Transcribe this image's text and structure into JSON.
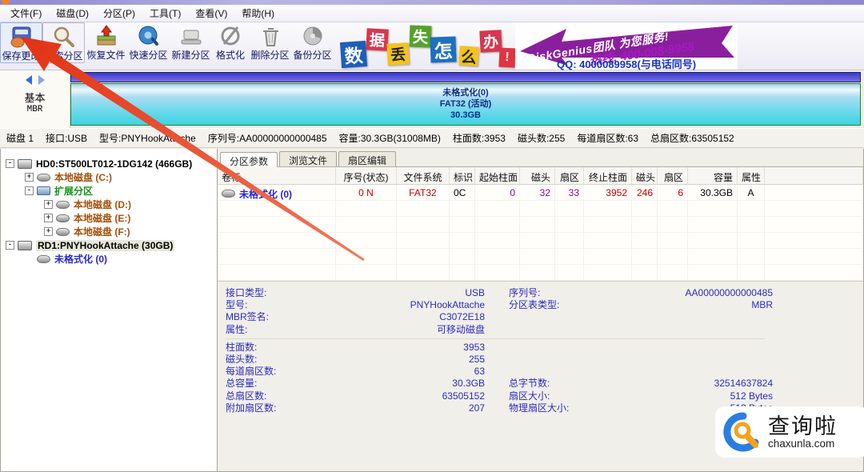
{
  "menu": {
    "items": [
      "文件(F)",
      "磁盘(D)",
      "分区(P)",
      "工具(T)",
      "查看(V)",
      "帮助(H)"
    ]
  },
  "toolbar": {
    "buttons": [
      {
        "label": "保存更改",
        "icon": "save-icon"
      },
      {
        "label": "搜索分区",
        "icon": "search-icon"
      },
      {
        "label": "恢复文件",
        "icon": "recover-icon"
      },
      {
        "label": "快速分区",
        "icon": "quick-partition-icon"
      },
      {
        "label": "新建分区",
        "icon": "new-partition-icon"
      },
      {
        "label": "格式化",
        "icon": "format-icon"
      },
      {
        "label": "删除分区",
        "icon": "trash-icon"
      },
      {
        "label": "备份分区",
        "icon": "backup-icon"
      }
    ]
  },
  "ad": {
    "slogan_chars": [
      "数",
      "据",
      "丢",
      "失",
      "怎",
      "么",
      "办",
      "!"
    ],
    "brand": "DiskGenius团队 为您服务!",
    "hotline": "热线: 400-008-9958",
    "qq": "QQ: 4000089958(与电话同号)",
    "arrow_color": "#8a1f9e"
  },
  "diskmap": {
    "kind": "基本",
    "table_type": "MBR",
    "partition": {
      "name": "未格式化(0)",
      "fs": "FAT32 (活动)",
      "size": "30.3GB"
    }
  },
  "diskinfo": {
    "segments": [
      "磁盘 1",
      "接口:USB",
      "型号:PNYHookAttache",
      "序列号:AA00000000000485",
      "容量:30.3GB(31008MB)",
      "柱面数:3953",
      "磁头数:255",
      "每道扇区数:63",
      "总扇区数:63505152"
    ]
  },
  "tree": {
    "items": [
      {
        "label": "HD0:ST500LT012-1DG142 (466GB)",
        "expander": "-"
      },
      {
        "label": "本地磁盘 (C:)",
        "expander": "+"
      },
      {
        "label": "扩展分区",
        "expander": "-"
      },
      {
        "label": "本地磁盘 (D:)",
        "expander": "+"
      },
      {
        "label": "本地磁盘 (E:)",
        "expander": "+"
      },
      {
        "label": "本地磁盘 (F:)",
        "expander": "+"
      },
      {
        "label": "RD1:PNYHookAttache (30GB)",
        "expander": "-"
      },
      {
        "label": "未格式化 (0)",
        "expander": ""
      }
    ]
  },
  "tabs": [
    {
      "label": "分区参数",
      "active": true
    },
    {
      "label": "浏览文件",
      "active": false
    },
    {
      "label": "扇区编辑",
      "active": false
    }
  ],
  "table": {
    "headers": [
      "卷标",
      "序号(状态)",
      "文件系统",
      "标识",
      "起始柱面",
      "磁头",
      "扇区",
      "终止柱面",
      "磁头",
      "扇区",
      "容量",
      "属性"
    ],
    "row": [
      "未格式化 (0)",
      "0 N",
      "FAT32",
      "0C",
      "0",
      "32",
      "33",
      "3952",
      "246",
      "6",
      "30.3GB",
      "A"
    ]
  },
  "details": {
    "rows": [
      {
        "l1": "接口类型:",
        "v1": "USB",
        "l2": "序列号:",
        "v2": "AA00000000000485"
      },
      {
        "l1": "型号:",
        "v1": "PNYHookAttache",
        "l2": "分区表类型:",
        "v2": "MBR"
      },
      {
        "l1": "MBR签名:",
        "v1": "C3072E18",
        "l2": "",
        "v2": ""
      },
      {
        "l1": "属性:",
        "v1": "可移动磁盘",
        "l2": "",
        "v2": ""
      },
      {
        "l1": "柱面数:",
        "v1": "3953",
        "l2": "",
        "v2": ""
      },
      {
        "l1": "磁头数:",
        "v1": "255",
        "l2": "",
        "v2": ""
      },
      {
        "l1": "每道扇区数:",
        "v1": "63",
        "l2": "",
        "v2": ""
      },
      {
        "l1": "总容量:",
        "v1": "30.3GB",
        "l2": "总字节数:",
        "v2": "32514637824"
      },
      {
        "l1": "总扇区数:",
        "v1": "63505152",
        "l2": "扇区大小:",
        "v2": "512 Bytes"
      },
      {
        "l1": "附加扇区数:",
        "v1": "207",
        "l2": "物理扇区大小:",
        "v2": "512 Bytes"
      }
    ]
  },
  "watermark": {
    "title": "查询啦",
    "domain": "chaxunla.com"
  },
  "annotation": {
    "type": "red-arrow",
    "points_to": "保存更改"
  },
  "palette": {
    "link_blue": "#2626d8",
    "tree_brown": "#a3520b",
    "tree_green": "#149414",
    "value_blue": "#2b2bbe",
    "row_red": "#c00000",
    "row_purple": "#8800a8",
    "partition_text": "#0d2f86"
  }
}
